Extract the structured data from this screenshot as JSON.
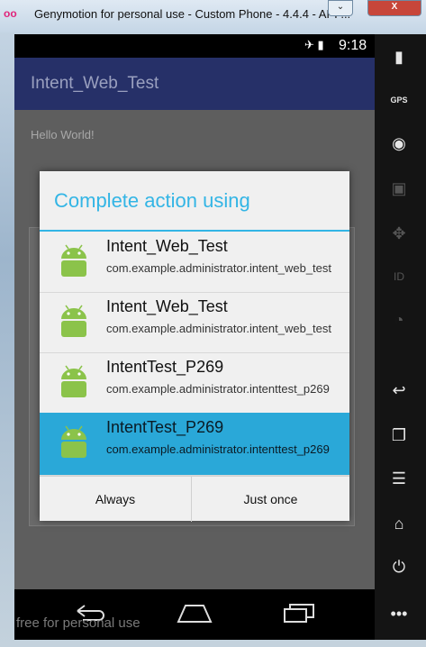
{
  "window": {
    "title": "Genymotion for personal use - Custom Phone - 4.4.4 - API ...",
    "logo": "oo",
    "minimize_label": "⌄",
    "close_label": "X"
  },
  "status_bar": {
    "time": "9:18",
    "icons": "✈ ▮"
  },
  "app": {
    "title": "Intent_Web_Test",
    "hello": "Hello World!"
  },
  "dialog": {
    "title": "Complete action using",
    "items": [
      {
        "name": "Intent_Web_Test",
        "package": "com.example.administrator.intent_web_test"
      },
      {
        "name": "Intent_Web_Test",
        "package": "com.example.administrator.intent_web_test"
      },
      {
        "name": "IntentTest_P269",
        "package": "com.example.administrator.intenttest_p269"
      },
      {
        "name": "IntentTest_P269",
        "package": "com.example.administrator.intenttest_p269"
      }
    ],
    "always_label": "Always",
    "just_once_label": "Just once"
  },
  "watermark": "free for personal use",
  "sidebar": {
    "gps_label": "GPS",
    "id_label": "ID"
  },
  "colors": {
    "accent": "#33b5e5",
    "selected": "#2aa8d8",
    "actionbar": "#263068"
  }
}
